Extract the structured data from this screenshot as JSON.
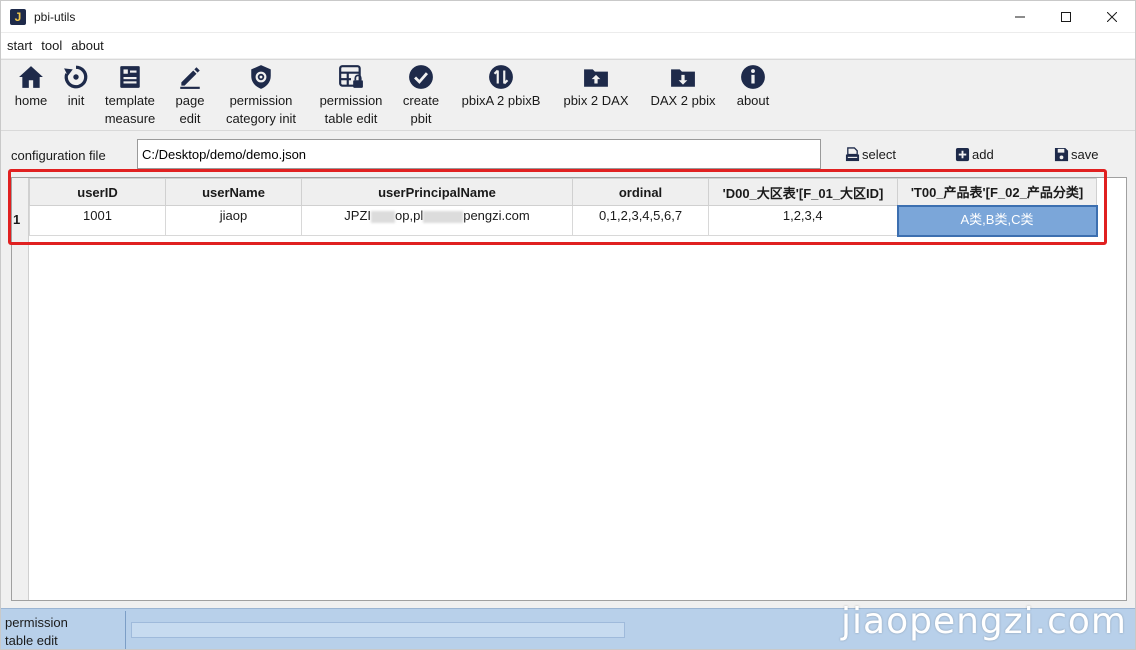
{
  "window": {
    "app_icon_letter": "J",
    "title": "pbi-utils"
  },
  "menu": [
    "start",
    "tool",
    "about"
  ],
  "toolbar": [
    {
      "id": "home",
      "label": "home",
      "icon": "home-icon"
    },
    {
      "id": "init",
      "label": "init",
      "icon": "refresh-icon"
    },
    {
      "id": "template",
      "label": "template\nmeasure",
      "icon": "template-icon"
    },
    {
      "id": "page-edit",
      "label": "page\nedit",
      "icon": "pencil-icon"
    },
    {
      "id": "perm-cat",
      "label": "permission\ncategory init",
      "icon": "shield-gear-icon"
    },
    {
      "id": "perm-table",
      "label": "permission\ntable edit",
      "icon": "table-lock-icon"
    },
    {
      "id": "create",
      "label": "create\npbit",
      "icon": "check-circle-icon"
    },
    {
      "id": "pbixA2B",
      "label": "pbixA 2 pbixB",
      "icon": "swap-icon"
    },
    {
      "id": "pbix2dax",
      "label": "pbix 2 DAX",
      "icon": "upload-folder-icon"
    },
    {
      "id": "dax2pbix",
      "label": "DAX 2 pbix",
      "icon": "download-folder-icon"
    },
    {
      "id": "about",
      "label": "about",
      "icon": "info-icon"
    }
  ],
  "config": {
    "label": "configuration file",
    "value": "C:/Desktop/demo/demo.json",
    "select_label": "select",
    "add_label": "add",
    "save_label": "save"
  },
  "table": {
    "columns": [
      "userID",
      "userName",
      "userPrincipalName",
      "ordinal",
      "'D00_大区表'[F_01_大区ID]",
      "'T00_产品表'[F_02_产品分类]"
    ],
    "row_number": "1",
    "rows": [
      {
        "userID": "1001",
        "userName": "jiaop",
        "upn_a": "JPZI",
        "upn_b": "op,pl",
        "upn_c": "pengzi.com",
        "ordinal": "0,1,2,3,4,5,6,7",
        "region": "1,2,3,4",
        "product": "A类,B类,C类"
      }
    ]
  },
  "status": {
    "text": "permission\ntable edit",
    "watermark": "jiaopengzi.com"
  },
  "colors": {
    "highlight": "#e02020",
    "selected_cell": "#7ba6d9",
    "status_bar": "#b8d0ea",
    "icon": "#1e2a4a"
  }
}
